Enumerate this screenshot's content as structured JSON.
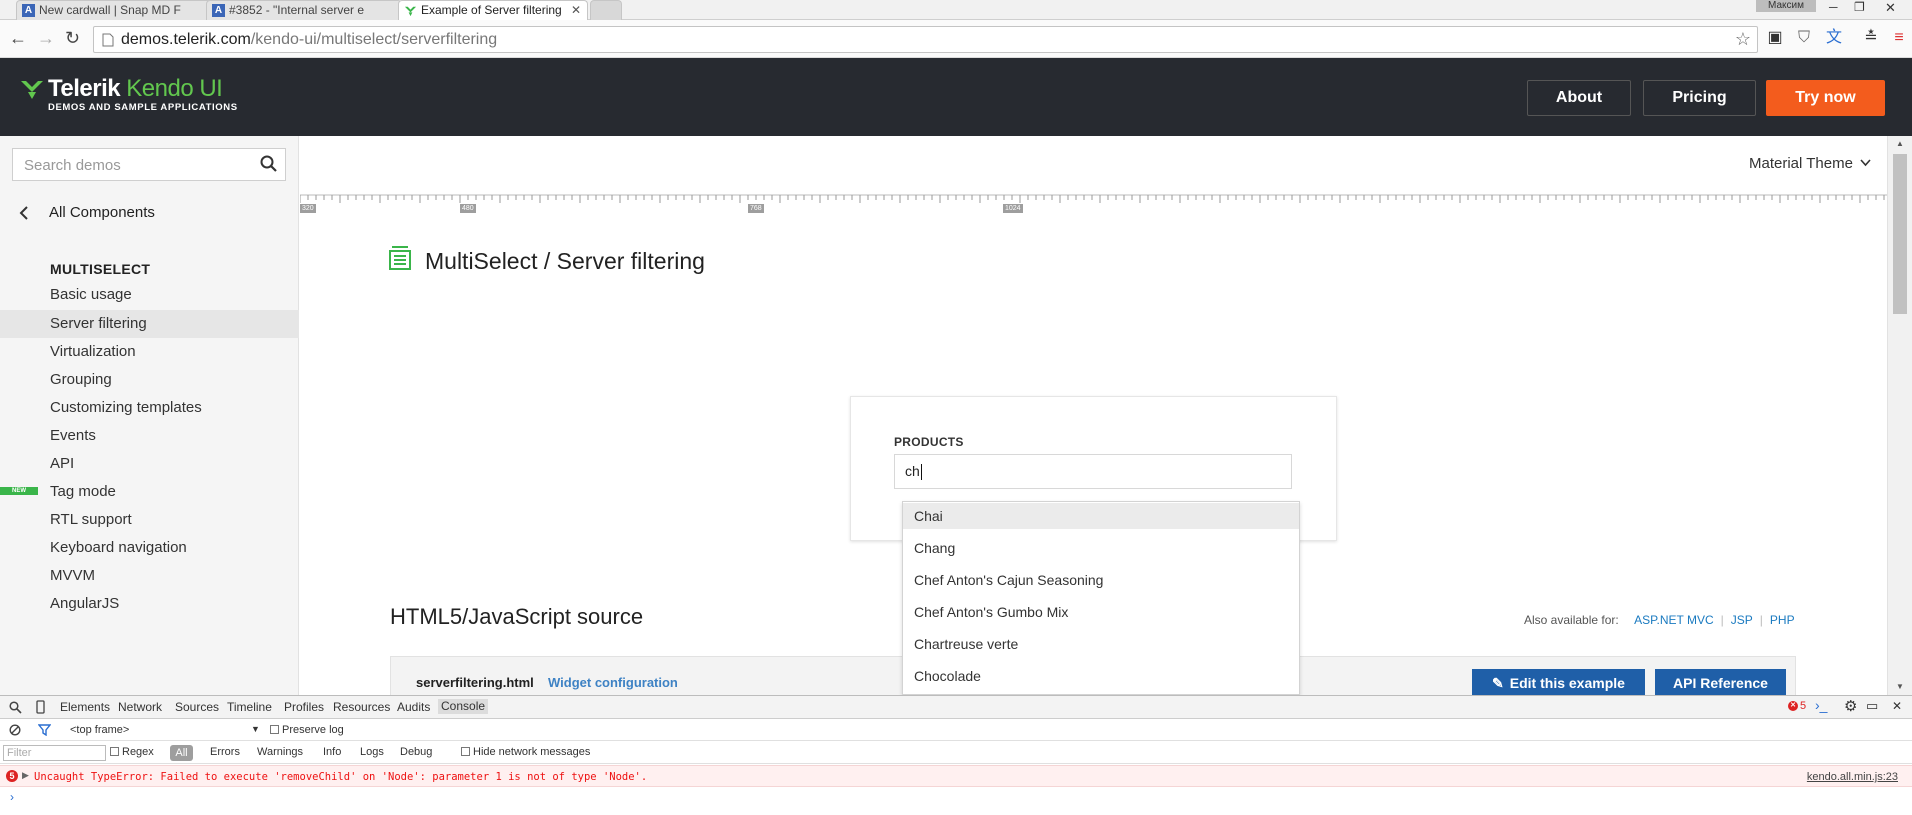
{
  "browser": {
    "tabs": [
      {
        "title": "New cardwall | Snap MD F"
      },
      {
        "title": "#3852 - \"Internal server e"
      },
      {
        "title": "Example of Server filtering"
      }
    ],
    "user": "Максим",
    "url_host": "demos.telerik.com",
    "url_path": "/kendo-ui/multiselect/serverfiltering"
  },
  "header": {
    "brand_bold": "Telerik",
    "brand_light": "Kendo UI",
    "subtitle": "DEMOS AND SAMPLE APPLICATIONS",
    "about": "About",
    "pricing": "Pricing",
    "try_now": "Try now"
  },
  "sidebar": {
    "search_placeholder": "Search demos",
    "back_label": "All Components",
    "section": "MULTISELECT",
    "new_badge": "NEW",
    "items": [
      {
        "label": "Basic usage"
      },
      {
        "label": "Server filtering"
      },
      {
        "label": "Virtualization"
      },
      {
        "label": "Grouping"
      },
      {
        "label": "Customizing templates"
      },
      {
        "label": "Events"
      },
      {
        "label": "API"
      },
      {
        "label": "Tag mode"
      },
      {
        "label": "RTL support"
      },
      {
        "label": "Keyboard navigation"
      },
      {
        "label": "MVVM"
      },
      {
        "label": "AngularJS"
      }
    ]
  },
  "main": {
    "theme": "Material Theme",
    "ruler_labels": [
      "320",
      "480",
      "768",
      "1024"
    ],
    "title": "MultiSelect / Server filtering",
    "demo": {
      "label": "PRODUCTS",
      "input_value": "ch",
      "options": [
        "Chai",
        "Chang",
        "Chef Anton's Cajun Seasoning",
        "Chef Anton's Gumbo Mix",
        "Chartreuse verte",
        "Chocolade"
      ]
    },
    "source_title": "HTML5/JavaScript source",
    "also_label": "Also available for:",
    "also_links": [
      "ASP.NET MVC",
      "JSP",
      "PHP"
    ],
    "file_tab": "serverfiltering.html",
    "config_tab": "Widget configuration",
    "edit_button": "Edit this example",
    "api_button": "API Reference"
  },
  "devtools": {
    "tabs": [
      "Elements",
      "Network",
      "Sources",
      "Timeline",
      "Profiles",
      "Resources",
      "Audits",
      "Console"
    ],
    "error_count": "5",
    "frame": "<top frame>",
    "preserve_log": "Preserve log",
    "filter_placeholder": "Filter",
    "regex": "Regex",
    "levels": [
      "All",
      "Errors",
      "Warnings",
      "Info",
      "Logs",
      "Debug"
    ],
    "hide_network": "Hide network messages",
    "error_badge": "5",
    "error_message": "Uncaught TypeError: Failed to execute 'removeChild' on 'Node': parameter 1 is not of type 'Node'.",
    "error_source": "kendo.all.min.js:23"
  },
  "colors": {
    "accent_green": "#62c74e",
    "try_orange": "#f35c1d",
    "header_bg": "#272a30",
    "button_blue": "#1f5fa8",
    "error_red": "#e11111"
  }
}
